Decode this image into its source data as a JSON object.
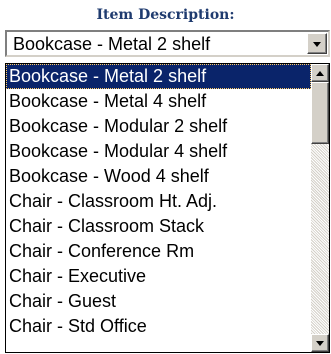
{
  "field": {
    "label": "Item Description:"
  },
  "select": {
    "value": "Bookcase - Metal 2 shelf"
  },
  "list": {
    "items": [
      "Bookcase - Metal 2 shelf",
      "Bookcase - Metal 4 shelf",
      "Bookcase - Modular 2 shelf",
      "Bookcase - Modular 4 shelf",
      "Bookcase - Wood 4 shelf",
      "Chair - Classroom Ht. Adj.",
      "Chair - Classroom Stack",
      "Chair - Conference Rm",
      "Chair - Executive",
      "Chair - Guest",
      "Chair - Std Office"
    ],
    "selected_index": 0
  },
  "icons": {
    "dropdown": "chevron-down-icon",
    "scroll_up": "arrow-up-icon",
    "scroll_down": "arrow-down-icon"
  },
  "colors": {
    "label": "#1f3b6f",
    "selection": "#0a246a",
    "control_face": "#d4d0c8"
  }
}
